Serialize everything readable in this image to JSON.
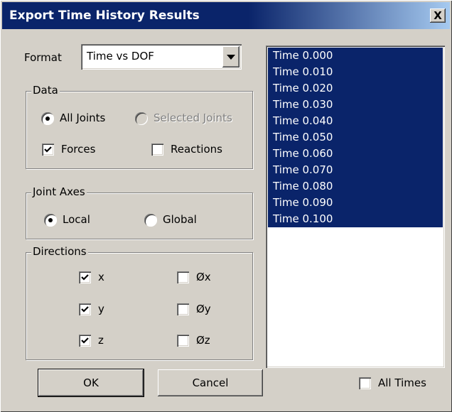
{
  "window": {
    "title": "Export Time History Results",
    "close_label": "X"
  },
  "format": {
    "label": "Format",
    "value": "Time vs DOF"
  },
  "data_group": {
    "legend": "Data",
    "all_joints": {
      "label": "All Joints",
      "selected": true
    },
    "selected_joints": {
      "label": "Selected Joints",
      "selected": false,
      "disabled": true
    },
    "forces": {
      "label": "Forces",
      "checked": true
    },
    "reactions": {
      "label": "Reactions",
      "checked": false
    }
  },
  "joint_axes": {
    "legend": "Joint Axes",
    "local": {
      "label": "Local",
      "selected": true
    },
    "global": {
      "label": "Global",
      "selected": false
    }
  },
  "directions": {
    "legend": "Directions",
    "x": {
      "label": "x",
      "checked": true
    },
    "y": {
      "label": "y",
      "checked": true
    },
    "z": {
      "label": "z",
      "checked": true
    },
    "rx": {
      "label": "Øx",
      "checked": false
    },
    "ry": {
      "label": "Øy",
      "checked": false
    },
    "rz": {
      "label": "Øz",
      "checked": false
    }
  },
  "times": {
    "items": [
      "Time 0.000",
      "Time 0.010",
      "Time 0.020",
      "Time 0.030",
      "Time 0.040",
      "Time 0.050",
      "Time 0.060",
      "Time 0.070",
      "Time 0.080",
      "Time 0.090",
      "Time 0.100"
    ],
    "all_times": {
      "label": "All Times",
      "checked": false
    }
  },
  "buttons": {
    "ok": "OK",
    "cancel": "Cancel"
  },
  "colors": {
    "selection": "#0a246a",
    "dialog_bg": "#d4d0c8"
  }
}
